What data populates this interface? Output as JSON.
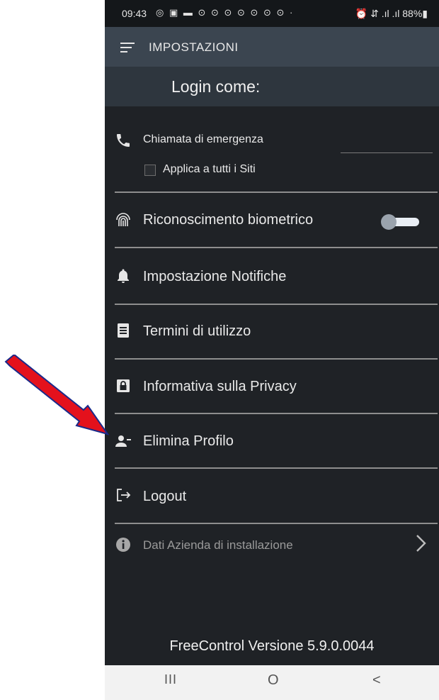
{
  "status_bar": {
    "time": "09:43",
    "notification_icons": "◎ ▣ ▬ ⊙ ⊙ ⊙ ⊙ ⊙ ⊙ ⊙ ·",
    "battery": "⏰ ⇵ .ıl .ıl 88%▮"
  },
  "app_bar": {
    "title": "IMPOSTAZIONI"
  },
  "login_header": {
    "text": "Login come:"
  },
  "emergency": {
    "label": "Chiamata di emergenza",
    "apply_all_label": "Applica a tutti i Siti"
  },
  "menu": {
    "biometric": "Riconoscimento biometrico",
    "notifications": "Impostazione Notifiche",
    "terms": "Termini di utilizzo",
    "privacy": "Informativa sulla Privacy",
    "delete_profile": "Elimina Profilo",
    "logout": "Logout",
    "company_data": "Dati Azienda di installazione"
  },
  "biometric_toggle": {
    "on": false
  },
  "footer": {
    "version": "FreeControl Versione 5.9.0.0044"
  },
  "nav_bar": {
    "recents": "III",
    "home": "O",
    "back": "<"
  },
  "colors": {
    "background": "#1f2226",
    "app_bar": "#3b4550",
    "login_band": "#2e363e",
    "annotation_arrow": "#e4111c"
  },
  "icons": [
    "phone-icon",
    "fingerprint-icon",
    "bell-icon",
    "document-icon",
    "lock-icon",
    "remove-user-icon",
    "logout-icon",
    "info-icon",
    "chevron-right-icon",
    "menu-icon"
  ]
}
